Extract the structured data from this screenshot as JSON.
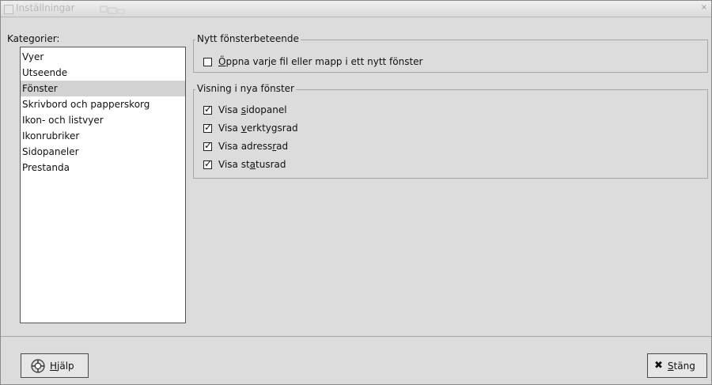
{
  "window": {
    "title": "Inställningar",
    "close_symbol": "×"
  },
  "categories": {
    "label": "Kategorier:",
    "items": [
      "Vyer",
      "Utseende",
      "Fönster",
      "Skrivbord och papperskorg",
      "Ikon- och listvyer",
      "Ikonrubriker",
      "Sidopaneler",
      "Prestanda"
    ],
    "selected": "Fönster"
  },
  "new_window_behavior": {
    "title": "Nytt fönsterbeteende",
    "open_each_in_new_window": {
      "u": "Ö",
      "rest": "ppna varje fil eller mapp i ett nytt fönster",
      "checked": false
    }
  },
  "new_window_display": {
    "title": "Visning i nya fönster",
    "options": [
      {
        "pre": "Visa ",
        "u": "s",
        "post": "idopanel",
        "checked": true
      },
      {
        "pre": "Visa ",
        "u": "v",
        "post": "erktygsrad",
        "checked": true
      },
      {
        "pre": "Visa adress",
        "u": "r",
        "post": "ad",
        "checked": true
      },
      {
        "pre": "Visa st",
        "u": "a",
        "post": "tusrad",
        "checked": true
      }
    ]
  },
  "buttons": {
    "help": {
      "u": "H",
      "rest": "jälp",
      "icon": "help-lifebuoy-icon"
    },
    "close": {
      "u": "S",
      "rest": "täng",
      "icon": "close-x-icon",
      "symbol": "✖"
    }
  }
}
